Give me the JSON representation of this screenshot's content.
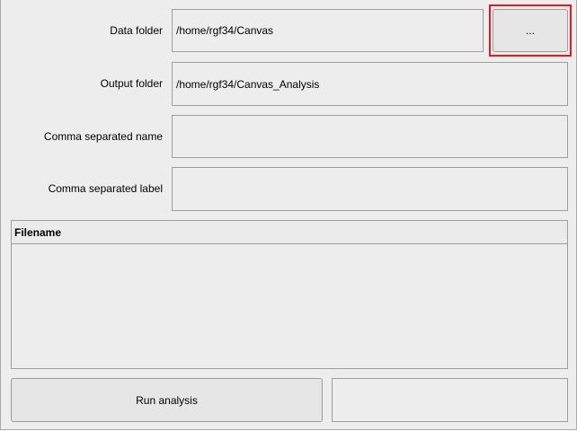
{
  "form": {
    "data_folder": {
      "label": "Data folder",
      "value": "/home/rgf34/Canvas",
      "browse_label": "..."
    },
    "output_folder": {
      "label": "Output folder",
      "value": "/home/rgf34/Canvas_Analysis"
    },
    "names": {
      "label": "Comma separated name",
      "value": ""
    },
    "labels": {
      "label": "Comma separated label",
      "value": ""
    }
  },
  "file_table": {
    "columns": [
      "Filename"
    ],
    "rows": []
  },
  "actions": {
    "run_label": "Run analysis",
    "status_text": ""
  },
  "colors": {
    "background": "#ededed",
    "border": "#9e9e9e",
    "highlight": "#e8181c"
  }
}
